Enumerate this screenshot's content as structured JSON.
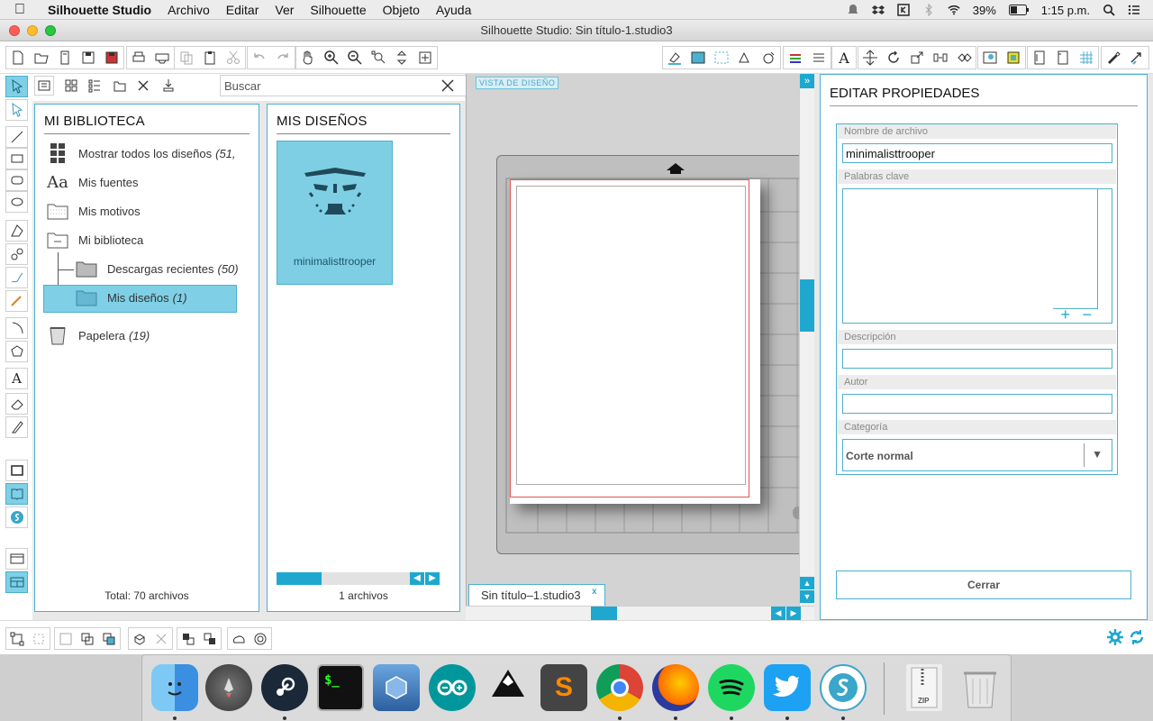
{
  "menubar": {
    "app_name": "Silhouette Studio",
    "items": [
      "Archivo",
      "Editar",
      "Ver",
      "Silhouette",
      "Objeto",
      "Ayuda"
    ],
    "battery": "39%",
    "clock": "1:15 p.m."
  },
  "window": {
    "title": "Silhouette Studio: Sin título-1.studio3"
  },
  "search": {
    "placeholder": "Buscar"
  },
  "library": {
    "title": "MI BIBLIOTECA",
    "items": [
      {
        "label": "Mostrar todos los diseños",
        "count": "(51,"
      },
      {
        "label": "Mis fuentes",
        "count": ""
      },
      {
        "label": "Mis motivos",
        "count": ""
      },
      {
        "label": "Mi biblioteca",
        "count": ""
      },
      {
        "label": "Descargas recientes",
        "count": "(50)"
      },
      {
        "label": "Mis diseños",
        "count": "(1)"
      },
      {
        "label": "Papelera",
        "count": "(19)"
      }
    ],
    "total": "Total: 70 archivos"
  },
  "designs": {
    "title": "MIS DISEÑOS",
    "thumbnail_label": "minimalisttrooper",
    "count": "1 archivos"
  },
  "canvas": {
    "view_label": "VISTA DE DISEÑO",
    "tab_label": "Sin título–1.studio3",
    "tab_close": "x"
  },
  "properties": {
    "title": "EDITAR PROPIEDADES",
    "filename_label": "Nombre de archivo",
    "filename_value": "minimalisttrooper",
    "keywords_label": "Palabras clave",
    "description_label": "Descripción",
    "author_label": "Autor",
    "category_label": "Categoría",
    "category_value": "Corte normal",
    "close_label": "Cerrar"
  },
  "colors": {
    "accent": "#4cb0cf",
    "selected_bg": "#7fd0e6",
    "thumb_bg": "#7ecfe4"
  }
}
